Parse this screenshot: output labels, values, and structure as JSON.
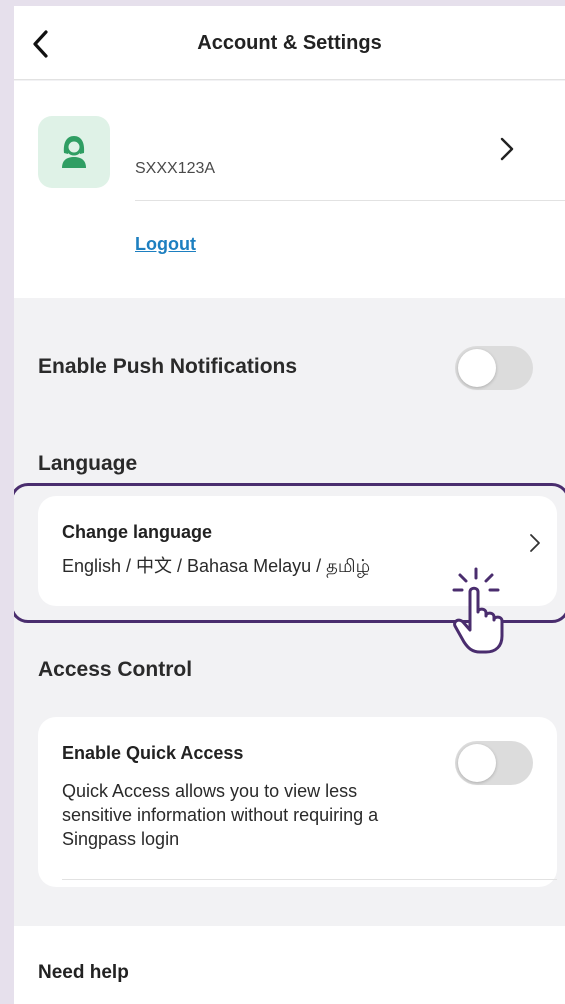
{
  "header": {
    "title": "Account & Settings",
    "back_icon": "chevron-left-icon"
  },
  "profile": {
    "avatar_icon": "person-icon",
    "id_text": "SXXX123A",
    "chevron_icon": "chevron-right-icon",
    "logout_label": "Logout"
  },
  "push_notifications": {
    "label": "Enable Push Notifications",
    "enabled": false
  },
  "language": {
    "heading": "Language",
    "card_title": "Change language",
    "options_text": "English / 中文 / Bahasa Melayu / தமிழ்",
    "chevron_icon": "chevron-right-icon"
  },
  "access_control": {
    "heading": "Access Control",
    "quick_access_title": "Enable Quick Access",
    "quick_access_description": "Quick Access allows you to view less sensitive information without requiring a Singpass login",
    "quick_access_enabled": false
  },
  "help": {
    "heading": "Need help"
  },
  "colors": {
    "link": "#1d7fc0",
    "avatar_bg": "#dff2e7",
    "avatar_fg": "#2f9e63",
    "highlight": "#4a2d6e",
    "page_bg": "#f2f2f4"
  }
}
